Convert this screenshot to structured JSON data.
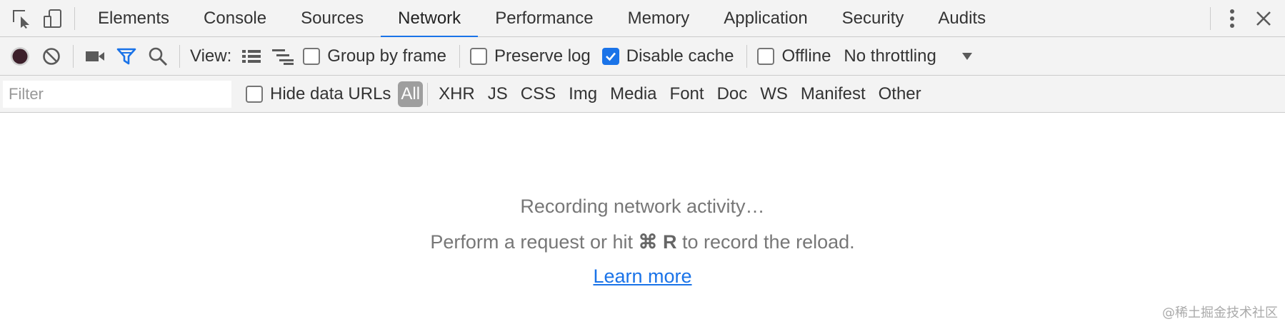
{
  "tabbar": {
    "tabs": [
      {
        "label": "Elements"
      },
      {
        "label": "Console"
      },
      {
        "label": "Sources"
      },
      {
        "label": "Network"
      },
      {
        "label": "Performance"
      },
      {
        "label": "Memory"
      },
      {
        "label": "Application"
      },
      {
        "label": "Security"
      },
      {
        "label": "Audits"
      }
    ],
    "active_tab": "Network",
    "icons": [
      "inspect-element-icon",
      "device-toolbar-icon",
      "more-options-icon",
      "close-icon"
    ]
  },
  "toolbar": {
    "icons": [
      "record-icon",
      "clear-icon",
      "screenshot-icon",
      "filter-icon",
      "search-icon",
      "large-rows-icon",
      "waterfall-icon"
    ],
    "view_label": "View:",
    "group_by_frame": {
      "label": "Group by frame",
      "checked": false
    },
    "preserve_log": {
      "label": "Preserve log",
      "checked": false
    },
    "disable_cache": {
      "label": "Disable cache",
      "checked": true
    },
    "offline": {
      "label": "Offline",
      "checked": false
    },
    "throttling": {
      "selected": "No throttling"
    }
  },
  "filterbar": {
    "placeholder": "Filter",
    "hide_data_urls": {
      "label": "Hide data URLs",
      "checked": false
    },
    "types": [
      "All",
      "XHR",
      "JS",
      "CSS",
      "Img",
      "Media",
      "Font",
      "Doc",
      "WS",
      "Manifest",
      "Other"
    ],
    "active_type": "All"
  },
  "content": {
    "line1": "Recording network activity…",
    "line2_prefix": "Perform a request or hit",
    "shortcut": "⌘ R",
    "line2_suffix": "to record the reload.",
    "learn_more": "Learn more"
  },
  "watermark": "@稀土掘金技术社区",
  "colors": {
    "accent": "#1a73e8",
    "record": "#3c1f2a",
    "toolbar_bg": "#f3f3f3",
    "active_type_bg": "#9e9e9e"
  }
}
